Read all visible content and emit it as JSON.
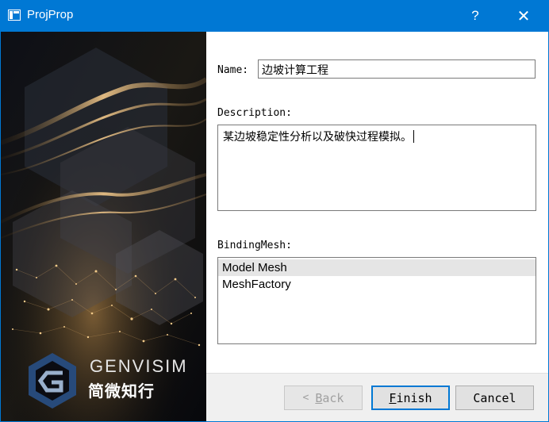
{
  "window": {
    "title": "ProjProp",
    "help_label": "?",
    "close_label": "✕",
    "icon": "window-app-icon"
  },
  "banner": {
    "brand_name": "GENVISIM",
    "brand_sub": "简微知行",
    "logo_icon": "genvisim-logo-icon"
  },
  "form": {
    "name_label": "Name:",
    "name_value": "边坡计算工程",
    "description_label": "Description:",
    "description_value": "某边坡稳定性分析以及破快过程模拟。",
    "binding_label": "BindingMesh:",
    "meshes": [
      {
        "label": "Model Mesh",
        "selected": true
      },
      {
        "label": "MeshFactory",
        "selected": false
      }
    ]
  },
  "buttons": {
    "back_arrow": "<",
    "back_mnemonic": "B",
    "back_rest": "ack",
    "finish_mnemonic": "F",
    "finish_rest": "inish",
    "cancel_label": "Cancel"
  },
  "colors": {
    "titlebar": "#0078d4",
    "accent": "#0078d4",
    "selection": "#e5e5e5"
  }
}
